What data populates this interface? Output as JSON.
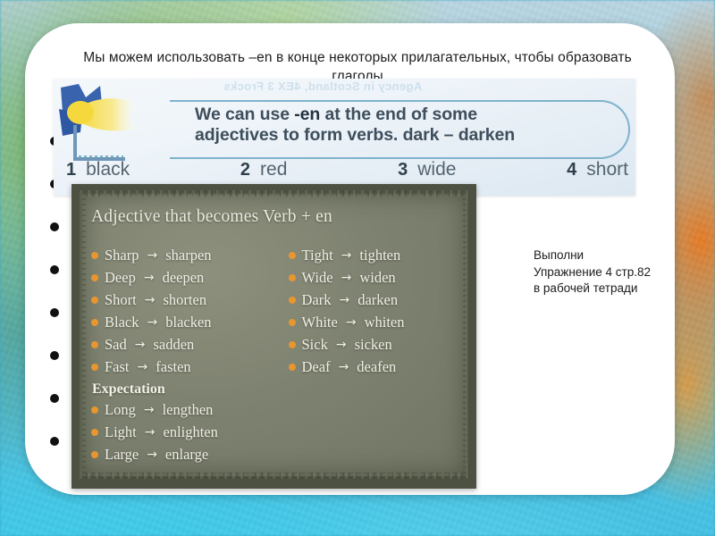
{
  "slide": {
    "title_line1": "Мы можем использовать –en в конце некоторых прилагательных, чтобы образовать",
    "title_line2": "глаголы",
    "bullet_count": 8,
    "bullet_icon": "bullet-dot-icon"
  },
  "textbook_image": {
    "decoration_icon": "blue-star-burst-icon",
    "ghost_text": "Agency in Scotland, 4EX 3 Frocks",
    "callout_line1_pre": "We can use ",
    "callout_line1_em": "-en",
    "callout_line1_post": " at the end of some",
    "callout_line2": "adjectives to form verbs.  dark – darken",
    "words": [
      {
        "num": "1",
        "word": "black"
      },
      {
        "num": "2",
        "word": "red"
      },
      {
        "num": "3",
        "word": "wide"
      },
      {
        "num": "4",
        "word": "short"
      }
    ]
  },
  "verb_card": {
    "heading": "Adjective that becomes Verb + en",
    "arrow_glyph": "→",
    "bullet_color": "#e8962f",
    "left_column": [
      {
        "adjective": "Sharp",
        "verb": "sharpen"
      },
      {
        "adjective": "Deep",
        "verb": "deepen"
      },
      {
        "adjective": "Short",
        "verb": "shorten"
      },
      {
        "adjective": "Black",
        "verb": "blacken"
      },
      {
        "adjective": "Sad",
        "verb": "sadden"
      },
      {
        "adjective": "Fast",
        "verb": "fasten"
      }
    ],
    "subheading": "Expectation",
    "left_column_extra": [
      {
        "adjective": "Long",
        "verb": "lengthen"
      },
      {
        "adjective": "Light",
        "verb": "enlighten"
      },
      {
        "adjective": "Large",
        "verb": "enlarge"
      }
    ],
    "right_column": [
      {
        "adjective": "Tight",
        "verb": "tighten"
      },
      {
        "adjective": "Wide",
        "verb": "widen"
      },
      {
        "adjective": "Dark",
        "verb": "darken"
      },
      {
        "adjective": "White",
        "verb": "whiten"
      },
      {
        "adjective": "Sick",
        "verb": "sicken"
      },
      {
        "adjective": "Deaf",
        "verb": "deafen"
      }
    ]
  },
  "homework_note": {
    "line1": "Выполни",
    "line2": "Упражнение 4 стр.82",
    "line3": "в рабочей тетради"
  }
}
